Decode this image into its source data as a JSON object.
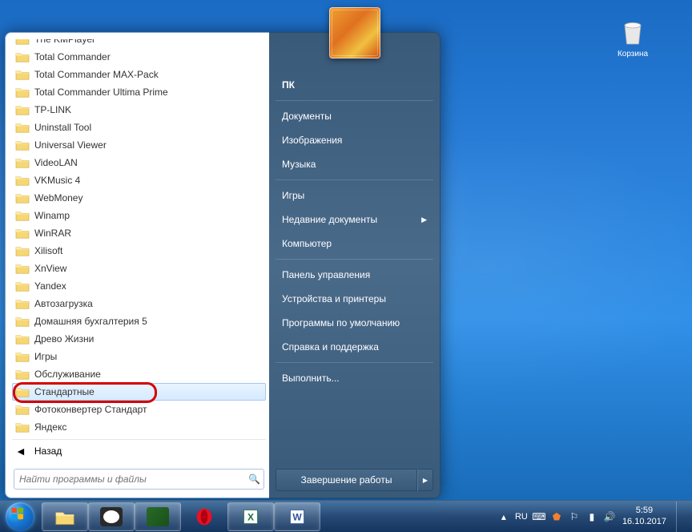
{
  "desktop": {
    "recycle_label": "Корзина"
  },
  "programs": [
    {
      "label": "The KMPlayer"
    },
    {
      "label": "Total Commander"
    },
    {
      "label": "Total Commander MAX-Pack"
    },
    {
      "label": "Total Commander Ultima Prime"
    },
    {
      "label": "TP-LINK"
    },
    {
      "label": "Uninstall Tool"
    },
    {
      "label": "Universal Viewer"
    },
    {
      "label": "VideoLAN"
    },
    {
      "label": "VKMusic 4"
    },
    {
      "label": "WebMoney"
    },
    {
      "label": "Winamp"
    },
    {
      "label": "WinRAR"
    },
    {
      "label": "Xilisoft"
    },
    {
      "label": "XnView"
    },
    {
      "label": "Yandex"
    },
    {
      "label": "Автозагрузка"
    },
    {
      "label": "Домашняя бухгалтерия 5"
    },
    {
      "label": "Древо Жизни"
    },
    {
      "label": "Игры"
    },
    {
      "label": "Обслуживание"
    },
    {
      "label": "Стандартные",
      "highlighted": true,
      "selected": true
    },
    {
      "label": "Фотоконвертер Стандарт"
    },
    {
      "label": "Яндекс"
    }
  ],
  "back_label": "Назад",
  "search_placeholder": "Найти программы и файлы",
  "right_menu": [
    {
      "label": "ПК",
      "bold": true
    },
    {
      "label": "Документы"
    },
    {
      "label": "Изображения"
    },
    {
      "label": "Музыка"
    },
    {
      "label": "Игры"
    },
    {
      "label": "Недавние документы",
      "submenu": true
    },
    {
      "label": "Компьютер"
    },
    {
      "label": "Панель управления"
    },
    {
      "label": "Устройства и принтеры"
    },
    {
      "label": "Программы по умолчанию"
    },
    {
      "label": "Справка и поддержка"
    },
    {
      "label": "Выполнить..."
    }
  ],
  "shutdown_label": "Завершение работы",
  "tray": {
    "lang": "RU",
    "time": "5:59",
    "date": "16.10.2017"
  }
}
